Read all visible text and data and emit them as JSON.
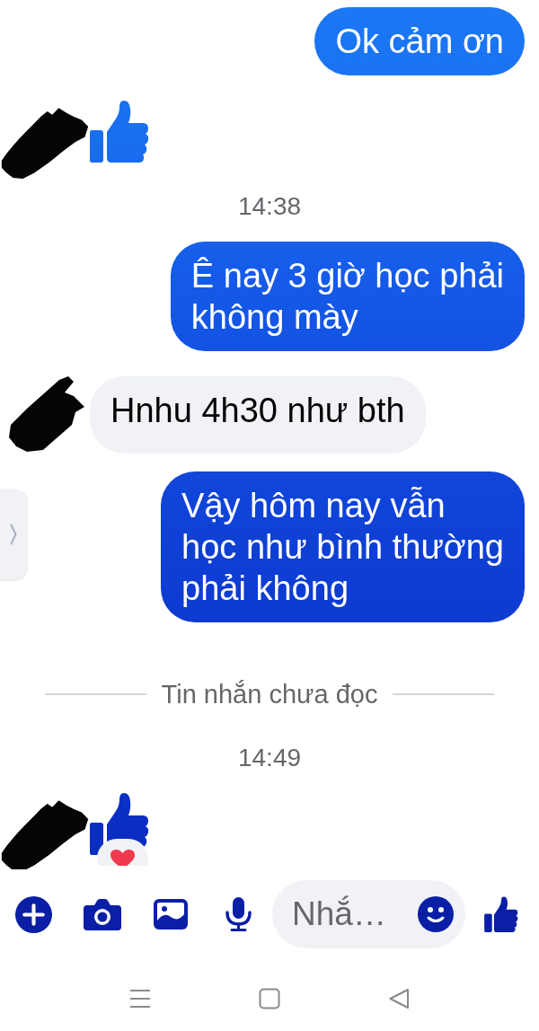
{
  "thread": [
    {
      "kind": "outgoing",
      "lines": [
        "Ok cảm ơn"
      ]
    },
    {
      "kind": "like",
      "reacted": false
    },
    {
      "kind": "time",
      "text": "14:38"
    },
    {
      "kind": "outgoing",
      "lines": [
        "Ê nay 3 giờ học phải",
        "không mày"
      ]
    },
    {
      "kind": "incoming",
      "lines": [
        "Hnhu 4h30 như bth"
      ]
    },
    {
      "kind": "outgoing",
      "lines": [
        "Vậy hôm nay vẫn",
        "học như bình thường",
        "phải không"
      ]
    },
    {
      "kind": "divider",
      "text": "Tin nhắn chưa đọc"
    },
    {
      "kind": "time",
      "text": "14:49"
    },
    {
      "kind": "like",
      "reacted": true
    }
  ],
  "composer": {
    "placeholder": "Nhắ…"
  }
}
